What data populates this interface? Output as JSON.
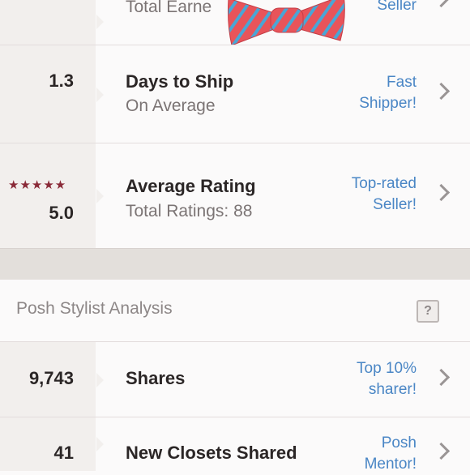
{
  "rows": {
    "partial": {
      "title": "Total Earne",
      "badge": "Seller"
    },
    "ship": {
      "value": "1.3",
      "title": "Days to Ship",
      "subtitle": "On Average",
      "badge_line1": "Fast",
      "badge_line2": "Shipper!"
    },
    "rating": {
      "stars": "★★★★★",
      "value": "5.0",
      "title": "Average Rating",
      "subtitle": "Total Ratings: 88",
      "badge_line1": "Top-rated",
      "badge_line2": "Seller!"
    },
    "shares": {
      "value": "9,743",
      "title": "Shares",
      "badge_line1": "Top 10%",
      "badge_line2": "sharer!"
    },
    "closets": {
      "value": "41",
      "title": "New Closets Shared",
      "badge_line1": "Posh",
      "badge_line2": "Mentor!"
    }
  },
  "section": {
    "title": "Posh Stylist Analysis",
    "help": "?"
  },
  "colors": {
    "accent": "#4a86c5",
    "star": "#8a2a38",
    "metric_bg": "#f2efed"
  },
  "icons": [
    "bowtie-icon",
    "chevron-right-icon",
    "help-icon",
    "star-icon"
  ]
}
